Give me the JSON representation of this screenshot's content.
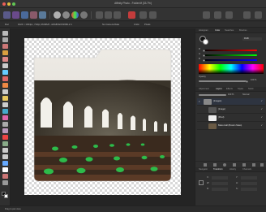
{
  "window": {
    "title": "Affinity Photo - Folder.tif (33.7%)"
  },
  "context_bar": {
    "items": [
      "Doc",
      "1024 × 1024px, 72dpi, RGBA/8 - sRGB IEC61966-2.1",
      "No Camera Data",
      "Units:",
      "Pixels"
    ]
  },
  "colors": {
    "close": "#ec5f57",
    "minimize": "#e0bd3e",
    "maximize": "#62c654",
    "accent": "#3d88ff",
    "slider_red": "#e23b3b"
  },
  "color_panel": {
    "tabs": [
      "Histogram",
      "Color",
      "Swatches",
      "Brushes"
    ],
    "active_tab": "Color",
    "mode": "RGB",
    "channels": [
      "R",
      "G",
      "B"
    ],
    "opacity_label": "Opacity",
    "opacity_value": "100 %"
  },
  "layers_panel": {
    "tabs": [
      "Adjustment",
      "Layers",
      "Effects",
      "Styles",
      "Stock"
    ],
    "active_tab": "Layers",
    "opacity_value": "100 %",
    "blend_mode": "Normal",
    "layers": [
      {
        "name": "(Images)",
        "icon": "folder-icon"
      },
      {
        "name": "(Image)",
        "icon": "image-icon"
      },
      {
        "name": "(Pixel)",
        "icon": "pixel-icon"
      },
      {
        "name": "Bates Hall (Boston Mass)",
        "icon": "image-icon"
      }
    ]
  },
  "navigator_panel": {
    "tabs": [
      "Navigator",
      "Transform",
      "History",
      "Channels"
    ],
    "active_tab": "Transform",
    "fields": [
      "X:",
      "Y:",
      "W:",
      "H:",
      "R:",
      "S:"
    ]
  },
  "status": {
    "text": "Drag to pan view."
  }
}
